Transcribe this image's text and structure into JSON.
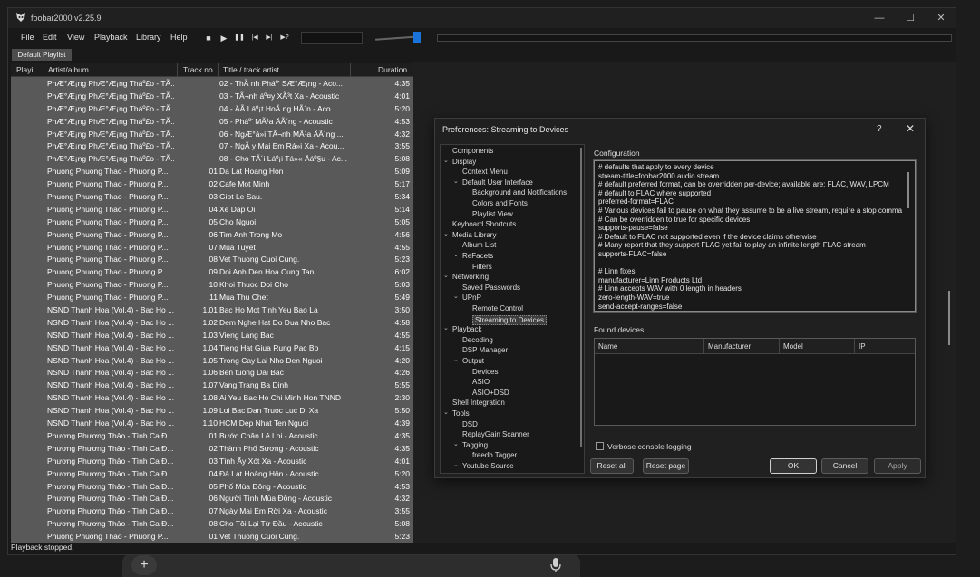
{
  "app": {
    "title": "foobar2000 v2.25.9"
  },
  "menu": [
    "File",
    "Edit",
    "View",
    "Playback",
    "Library",
    "Help"
  ],
  "toolbar": {
    "stop": "■",
    "play": "▶",
    "pause": "❚❚",
    "prev": "|◀",
    "next": "▶|",
    "random": "▶?"
  },
  "playlist": {
    "tab": "Default Playlist",
    "columns": {
      "playing": "Playi...",
      "artist_album": "Artist/album",
      "track_no": "Track no",
      "title_artist": "Title / track artist",
      "duration": "Duration"
    },
    "rows": [
      {
        "aa": "PhÆ°Æ¡ng PhÆ°Æ¡ng Tháº£o - TÃ...",
        "tn": "",
        "ti": "02 - ThÃ nh Pháº' SÆ°Æ¡ng - Aco...",
        "du": "4:35"
      },
      {
        "aa": "PhÆ°Æ¡ng PhÆ°Æ¡ng Tháº£o - TÃ...",
        "tn": "",
        "ti": "03 - TÃ¬nh áº¤y XÃ³t Xa - Acoustic",
        "du": "4:01"
      },
      {
        "aa": "PhÆ°Æ¡ng PhÆ°Æ¡ng Tháº£o - TÃ...",
        "tn": "",
        "ti": "04 - ÄÃ  Láº¡t HoÃ ng HÃ´n - Aco...",
        "du": "5:20"
      },
      {
        "aa": "PhÆ°Æ¡ng PhÆ°Æ¡ng Tháº£o - TÃ...",
        "tn": "",
        "ti": "05 - Pháº' MÃ¹a ÄÃ´ng - Acoustic",
        "du": "4:53"
      },
      {
        "aa": "PhÆ°Æ¡ng PhÆ°Æ¡ng Tháº£o - TÃ...",
        "tn": "",
        "ti": "06 - NgÆ°á»i TÃ¬nh MÃ¹a ÄÃ´ng ...",
        "du": "4:32"
      },
      {
        "aa": "PhÆ°Æ¡ng PhÆ°Æ¡ng Tháº£o - TÃ...",
        "tn": "",
        "ti": "07 - NgÃ y Mai Em Rá»i Xa - Acou...",
        "du": "3:55"
      },
      {
        "aa": "PhÆ°Æ¡ng PhÆ°Æ¡ng Tháº£o - TÃ...",
        "tn": "",
        "ti": "08 - Cho TÃ´i Láº¡i Tá»« Äáº§u - Ac...",
        "du": "5:08"
      },
      {
        "aa": "Phuong Phuong Thao - Phuong P...",
        "tn": "01",
        "ti": "Da Lat Hoang Hon",
        "du": "5:09"
      },
      {
        "aa": "Phuong Phuong Thao - Phuong P...",
        "tn": "02",
        "ti": "Cafe Mot Minh",
        "du": "5:17"
      },
      {
        "aa": "Phuong Phuong Thao - Phuong P...",
        "tn": "03",
        "ti": "Giot Le Sau.",
        "du": "5:34"
      },
      {
        "aa": "Phuong Phuong Thao - Phuong P...",
        "tn": "04",
        "ti": "Xe Dap Oi",
        "du": "5:14"
      },
      {
        "aa": "Phuong Phuong Thao - Phuong P...",
        "tn": "05",
        "ti": "Cho Nguoi",
        "du": "5:05"
      },
      {
        "aa": "Phuong Phuong Thao - Phuong P...",
        "tn": "06",
        "ti": "Tim Anh Trong Mo",
        "du": "4:56"
      },
      {
        "aa": "Phuong Phuong Thao - Phuong P...",
        "tn": "07",
        "ti": "Mua Tuyet",
        "du": "4:55"
      },
      {
        "aa": "Phuong Phuong Thao - Phuong P...",
        "tn": "08",
        "ti": "Vet Thuong Cuoi Cung.",
        "du": "5:23"
      },
      {
        "aa": "Phuong Phuong Thao - Phuong P...",
        "tn": "09",
        "ti": "Doi Anh Den Hoa Cung Tan",
        "du": "6:02"
      },
      {
        "aa": "Phuong Phuong Thao - Phuong P...",
        "tn": "10",
        "ti": "Khoi Thuoc Doi Cho",
        "du": "5:03"
      },
      {
        "aa": "Phuong Phuong Thao - Phuong P...",
        "tn": "11",
        "ti": "Mua Thu Chet",
        "du": "5:49"
      },
      {
        "aa": "NSND Thanh Hoa (Vol.4) - Bac Ho ...",
        "tn": "1.01",
        "ti": "Bac Ho Mot Tinh Yeu Bao La",
        "du": "3:50"
      },
      {
        "aa": "NSND Thanh Hoa (Vol.4) - Bac Ho ...",
        "tn": "1.02",
        "ti": "Dem Nghe Hat Do Dua Nho Bac",
        "du": "4:58"
      },
      {
        "aa": "NSND Thanh Hoa (Vol.4) - Bac Ho ...",
        "tn": "1.03",
        "ti": "Vieng Lang Bac",
        "du": "4:55"
      },
      {
        "aa": "NSND Thanh Hoa (Vol.4) - Bac Ho ...",
        "tn": "1.04",
        "ti": "Tieng Hat Giua Rung Pac Bo",
        "du": "4:15"
      },
      {
        "aa": "NSND Thanh Hoa (Vol.4) - Bac Ho ...",
        "tn": "1.05",
        "ti": "Trong Cay Lai Nho Den Nguoi",
        "du": "4:20"
      },
      {
        "aa": "NSND Thanh Hoa (Vol.4) - Bac Ho ...",
        "tn": "1.06",
        "ti": "Ben tuong Dai Bac",
        "du": "4:26"
      },
      {
        "aa": "NSND Thanh Hoa (Vol.4) - Bac Ho ...",
        "tn": "1.07",
        "ti": "Vang Trang Ba Dinh",
        "du": "5:55"
      },
      {
        "aa": "NSND Thanh Hoa (Vol.4) - Bac Ho ...",
        "tn": "1.08",
        "ti": "Ai Yeu Bac Ho Chi Minh Hon TNND",
        "du": "2:30"
      },
      {
        "aa": "NSND Thanh Hoa (Vol.4) - Bac Ho ...",
        "tn": "1.09",
        "ti": "Loi Bac Dan Truoc Luc Di Xa",
        "du": "5:50"
      },
      {
        "aa": "NSND Thanh Hoa (Vol.4) - Bac Ho ...",
        "tn": "1.10",
        "ti": "HCM Dep Nhat Ten Nguoi",
        "du": "4:39"
      },
      {
        "aa": "Phương Phương Thảo - Tình Ca Đ...",
        "tn": "01",
        "ti": "Bước Chân Lẻ Loi - Acoustic",
        "du": "4:35"
      },
      {
        "aa": "Phương Phương Thảo - Tình Ca Đ...",
        "tn": "02",
        "ti": "Thành Phố Sương - Acoustic",
        "du": "4:35"
      },
      {
        "aa": "Phương Phương Thảo - Tình Ca Đ...",
        "tn": "03",
        "ti": "Tình Ấy Xót Xa - Acoustic",
        "du": "4:01"
      },
      {
        "aa": "Phương Phương Thảo - Tình Ca Đ...",
        "tn": "04",
        "ti": "Đà Lạt Hoàng Hôn - Acoustic",
        "du": "5:20"
      },
      {
        "aa": "Phương Phương Thảo - Tình Ca Đ...",
        "tn": "05",
        "ti": "Phố Mùa Đông - Acoustic",
        "du": "4:53"
      },
      {
        "aa": "Phương Phương Thảo - Tình Ca Đ...",
        "tn": "06",
        "ti": "Người Tình Mùa Đông - Acoustic",
        "du": "4:32"
      },
      {
        "aa": "Phương Phương Thảo - Tình Ca Đ...",
        "tn": "07",
        "ti": "Ngày Mai Em Rời Xa - Acoustic",
        "du": "3:55"
      },
      {
        "aa": "Phương Phương Thảo - Tình Ca Đ...",
        "tn": "08",
        "ti": "Cho Tôi Lại Từ Đầu - Acoustic",
        "du": "5:08"
      },
      {
        "aa": "Phuong Phuong Thao - Phuong P...",
        "tn": "01",
        "ti": "Vet Thuong Cuoi Cung.",
        "du": "5:23"
      }
    ]
  },
  "status": "Playback stopped.",
  "dialog": {
    "title": "Preferences: Streaming to Devices",
    "help": "?",
    "close": "✕",
    "tree": [
      {
        "label": "Components",
        "level": 0,
        "exp": ""
      },
      {
        "label": "Display",
        "level": 0,
        "exp": "⌄"
      },
      {
        "label": "Context Menu",
        "level": 1,
        "exp": ""
      },
      {
        "label": "Default User Interface",
        "level": 1,
        "exp": "⌄"
      },
      {
        "label": "Background and Notifications",
        "level": 2,
        "exp": ""
      },
      {
        "label": "Colors and Fonts",
        "level": 2,
        "exp": ""
      },
      {
        "label": "Playlist View",
        "level": 2,
        "exp": ""
      },
      {
        "label": "Keyboard Shortcuts",
        "level": 0,
        "exp": ""
      },
      {
        "label": "Media Library",
        "level": 0,
        "exp": "⌄"
      },
      {
        "label": "Album List",
        "level": 1,
        "exp": ""
      },
      {
        "label": "ReFacets",
        "level": 1,
        "exp": "⌄"
      },
      {
        "label": "Filters",
        "level": 2,
        "exp": ""
      },
      {
        "label": "Networking",
        "level": 0,
        "exp": "⌄"
      },
      {
        "label": "Saved Passwords",
        "level": 1,
        "exp": ""
      },
      {
        "label": "UPnP",
        "level": 1,
        "exp": "⌄"
      },
      {
        "label": "Remote Control",
        "level": 2,
        "exp": ""
      },
      {
        "label": "Streaming to Devices",
        "level": 2,
        "exp": "",
        "selected": true
      },
      {
        "label": "Playback",
        "level": 0,
        "exp": "⌄"
      },
      {
        "label": "Decoding",
        "level": 1,
        "exp": ""
      },
      {
        "label": "DSP Manager",
        "level": 1,
        "exp": ""
      },
      {
        "label": "Output",
        "level": 1,
        "exp": "⌄"
      },
      {
        "label": "Devices",
        "level": 2,
        "exp": ""
      },
      {
        "label": "ASIO",
        "level": 2,
        "exp": ""
      },
      {
        "label": "ASIO+DSD",
        "level": 2,
        "exp": ""
      },
      {
        "label": "Shell Integration",
        "level": 0,
        "exp": ""
      },
      {
        "label": "Tools",
        "level": 0,
        "exp": "⌄"
      },
      {
        "label": "DSD",
        "level": 1,
        "exp": ""
      },
      {
        "label": "ReplayGain Scanner",
        "level": 1,
        "exp": ""
      },
      {
        "label": "Tagging",
        "level": 1,
        "exp": "⌄"
      },
      {
        "label": "freedb Tagger",
        "level": 2,
        "exp": ""
      },
      {
        "label": "Youtube Source",
        "level": 1,
        "exp": "⌄"
      }
    ],
    "config_label": "Configuration",
    "config_lines": [
      "# defaults that apply to every device",
      "stream-title=foobar2000 audio stream",
      "# default preferred format, can be overridden per-device; available are: FLAC, WAV, LPCM",
      "# default to FLAC where supported",
      "preferred-format=FLAC",
      "# Various devices fail to pause on what they assume to be a live stream, require a stop comma",
      "# Can be overridden to true for specific devices",
      "supports-pause=false",
      "# Default to FLAC not supported even if the device claims otherwise",
      "# Many report that they support FLAC yet fail to play an infinite length FLAC stream",
      "supports-FLAC=false",
      "",
      "# Linn fixes",
      "manufacturer=Linn Products Ltd",
      "# Linn accepts WAV with 0 length in headers",
      "zero-length-WAV=true",
      "send-accept-ranges=false"
    ],
    "found_label": "Found devices",
    "found_columns": [
      "Name",
      "Manufacturer",
      "Model",
      "IP"
    ],
    "verbose_label": "Verbose console logging",
    "buttons": {
      "reset_all": "Reset all",
      "reset_page": "Reset page",
      "ok": "OK",
      "cancel": "Cancel",
      "apply": "Apply"
    }
  }
}
